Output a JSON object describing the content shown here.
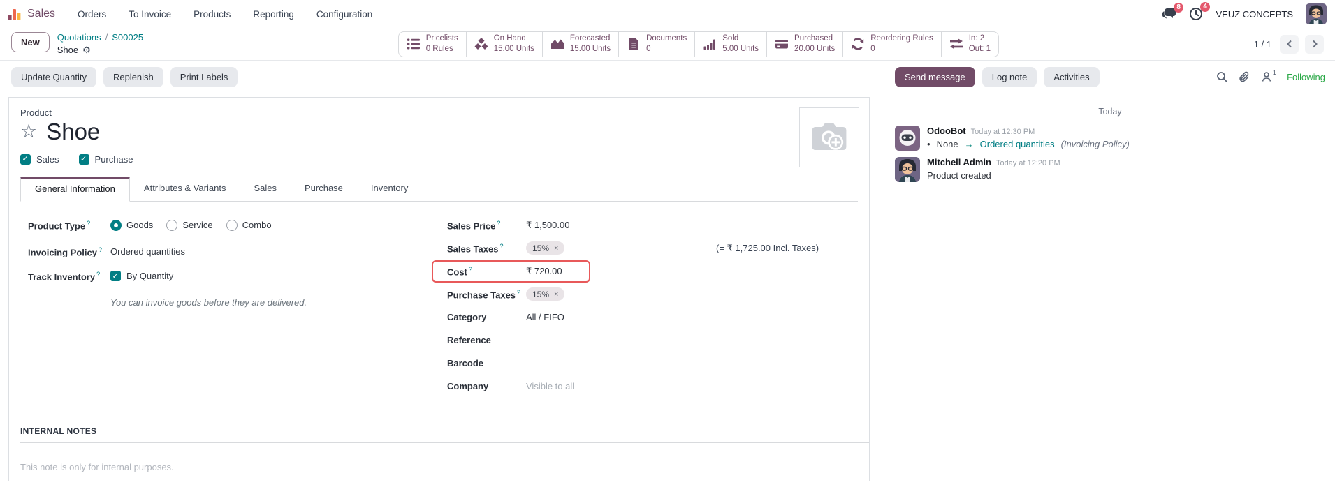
{
  "colors": {
    "brand": "#714B67",
    "link_teal": "#017e84",
    "following_green": "#28a745",
    "badge_red": "#e4586c",
    "highlight_red": "#e8595a"
  },
  "navbar": {
    "app_name": "Sales",
    "menus": [
      "Orders",
      "To Invoice",
      "Products",
      "Reporting",
      "Configuration"
    ],
    "message_badge": "8",
    "activity_badge": "4",
    "company": "VEUZ CONCEPTS"
  },
  "control_panel": {
    "new_button": "New",
    "breadcrumb_parent": "Quotations",
    "breadcrumb_sep": "/",
    "breadcrumb_record": "S00025",
    "breadcrumb_current": "Shoe",
    "gear_glyph": "⚙",
    "pager": "1 / 1"
  },
  "stat_buttons": [
    {
      "label": "Pricelists",
      "value": "0 Rules"
    },
    {
      "label": "On Hand",
      "value": "15.00 Units"
    },
    {
      "label": "Forecasted",
      "value": "15.00 Units"
    },
    {
      "label": "Documents",
      "value": "0"
    },
    {
      "label": "Sold",
      "value": "5.00 Units"
    },
    {
      "label": "Purchased",
      "value": "20.00 Units"
    },
    {
      "label": "Reordering Rules",
      "value": "0"
    },
    {
      "label": "In: 2",
      "value": "Out: 1"
    }
  ],
  "action_bar": {
    "update_quantity": "Update Quantity",
    "replenish": "Replenish",
    "print_labels": "Print Labels",
    "send_message": "Send message",
    "log_note": "Log note",
    "activities": "Activities",
    "follower_count": "1",
    "following": "Following"
  },
  "product": {
    "kicker": "Product",
    "star_glyph": "☆",
    "name": "Shoe",
    "sales_checkbox": "Sales",
    "purchase_checkbox": "Purchase"
  },
  "tabs": [
    "General Information",
    "Attributes & Variants",
    "Sales",
    "Purchase",
    "Inventory"
  ],
  "general_info": {
    "help_marker": "?",
    "left": {
      "product_type_label": "Product Type",
      "product_type_options": [
        "Goods",
        "Service",
        "Combo"
      ],
      "product_type_selected": "Goods",
      "invoicing_policy_label": "Invoicing Policy",
      "invoicing_policy_value": "Ordered quantities",
      "track_inventory_label": "Track Inventory",
      "track_inventory_value": "By Quantity",
      "helper": "You can invoice goods before they are delivered."
    },
    "right": {
      "sales_price_label": "Sales Price",
      "sales_price_value": "₹ 1,500.00",
      "sales_taxes_label": "Sales Taxes",
      "sales_taxes_tag": "15%",
      "tag_remove_glyph": "×",
      "incl_taxes_note": "(= ₹ 1,725.00 Incl. Taxes)",
      "cost_label": "Cost",
      "cost_value": "₹ 720.00",
      "purchase_taxes_label": "Purchase Taxes",
      "purchase_taxes_tag": "15%",
      "category_label": "Category",
      "category_value": "All / FIFO",
      "reference_label": "Reference",
      "reference_value": "",
      "barcode_label": "Barcode",
      "barcode_value": "",
      "company_label": "Company",
      "company_placeholder": "Visible to all"
    }
  },
  "internal_notes": {
    "heading": "INTERNAL NOTES",
    "placeholder": "This note is only for internal purposes."
  },
  "chatter": {
    "date_divider": "Today",
    "messages": [
      {
        "author": "OdooBot",
        "time": "Today at 12:30 PM",
        "bullet": "•",
        "tracking_old": "None",
        "tracking_arrow": "→",
        "tracking_new": "Ordered quantities",
        "tracking_field": "(Invoicing Policy)"
      },
      {
        "author": "Mitchell Admin",
        "time": "Today at 12:20 PM",
        "body": "Product created"
      }
    ]
  }
}
